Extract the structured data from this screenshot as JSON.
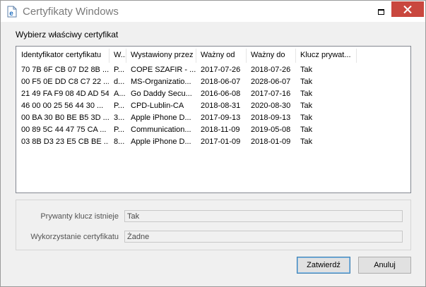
{
  "window": {
    "title": "Certyfikaty Windows",
    "icon": "document-e-icon",
    "accent_close": "#c9473e"
  },
  "instruction": "Wybierz właściwy certyfikat",
  "table": {
    "columns": [
      "Identyfikator certyfikatu",
      "W...",
      "Wystawiony przez",
      "Ważny od",
      "Ważny do",
      "Klucz prywat..."
    ],
    "rows": [
      [
        "70 7B 6F CB 07 D2 8B ...",
        "P...",
        "COPE SZAFIR - ...",
        "2017-07-26",
        "2018-07-26",
        "Tak"
      ],
      [
        "00 F5 0E DD C8 C7 22 ...",
        "d...",
        "MS-Organizatio...",
        "2018-06-07",
        "2028-06-07",
        "Tak"
      ],
      [
        "21 49 FA F9 08 4D AD 54",
        "A...",
        "Go Daddy Secu...",
        "2016-06-08",
        "2017-07-16",
        "Tak"
      ],
      [
        "46 00 00 25 56 44 30 ...",
        "P...",
        "CPD-Lublin-CA",
        "2018-08-31",
        "2020-08-30",
        "Tak"
      ],
      [
        "00 BA 30 B0 BE B5 3D ...",
        "3...",
        "Apple iPhone D...",
        "2017-09-13",
        "2018-09-13",
        "Tak"
      ],
      [
        "00 89 5C 44 47 75 CA ...",
        "P...",
        "Communication...",
        "2018-11-09",
        "2019-05-08",
        "Tak"
      ],
      [
        "03 8B D3 23 E5 CB BE ...",
        "8...",
        "Apple iPhone D...",
        "2017-01-09",
        "2018-01-09",
        "Tak"
      ]
    ]
  },
  "properties": {
    "private_key_label": "Prywanty klucz istnieje",
    "private_key_value": "Tak",
    "usage_label": "Wykorzystanie certyfikatu",
    "usage_value": "Żadne"
  },
  "buttons": {
    "confirm": "Zatwierdź",
    "cancel": "Anuluj"
  }
}
